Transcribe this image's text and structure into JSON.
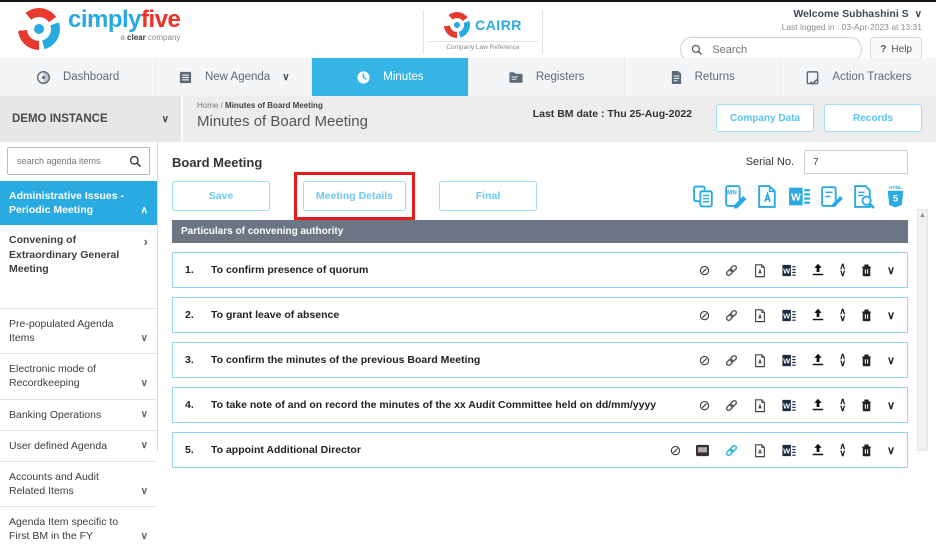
{
  "header": {
    "brand": {
      "cimply": "cimply",
      "five": "five",
      "tagline_pre": "a ",
      "tagline_bold": "clear",
      "tagline_post": " company"
    },
    "cairr": {
      "title": "CAIRR",
      "subtitle": "Company Law Reference"
    },
    "welcome": "Welcome Subhashini  S",
    "last_logged_in": "Last logged in : 03-Apr-2023 at 13:31",
    "search_placeholder": "Search",
    "help_q": "?",
    "help_label": "Help"
  },
  "nav": {
    "items": [
      {
        "label": "Dashboard",
        "icon": "dashboard-icon",
        "active": false
      },
      {
        "label": "New Agenda",
        "icon": "new-agenda-icon",
        "active": false,
        "has_dropdown": true
      },
      {
        "label": "Minutes",
        "icon": "clock-icon",
        "active": true
      },
      {
        "label": "Registers",
        "icon": "folder-icon",
        "active": false
      },
      {
        "label": "Returns",
        "icon": "document-icon",
        "active": false
      },
      {
        "label": "Action Trackers",
        "icon": "clipboard-check-icon",
        "active": false
      }
    ]
  },
  "band": {
    "instance": "DEMO INSTANCE",
    "breadcrumb_home": "Home",
    "breadcrumb_sep": "/",
    "breadcrumb_current": "Minutes of Board Meeting",
    "page_title": "Minutes of Board Meeting",
    "last_bm_date": "Last BM date : Thu 25-Aug-2022",
    "company_data_label": "Company Data",
    "records_label": "Records"
  },
  "sidebar": {
    "search_placeholder": "search agenda items",
    "items": [
      {
        "label": "Administrative Issues - Periodic Meeting",
        "chevron": "up",
        "active": true
      },
      {
        "label": "Convening of Extraordinary General Meeting",
        "chevron": "right",
        "active": false
      },
      {
        "label": "Pre-populated Agenda Items",
        "chevron": "down",
        "active": false
      },
      {
        "label": "Electronic mode of Recordkeeping",
        "chevron": "down",
        "active": false
      },
      {
        "label": "Banking Operations",
        "chevron": "down",
        "active": false
      },
      {
        "label": "User defined Agenda",
        "chevron": "down",
        "active": false
      },
      {
        "label": "Accounts and Audit Related Items",
        "chevron": "down",
        "active": false
      },
      {
        "label": "Agenda Item specific to First BM in the FY",
        "chevron": "down",
        "active": false
      }
    ],
    "chev_up": "∧",
    "chev_down": "∨",
    "chev_right": "›"
  },
  "main": {
    "title": "Board Meeting",
    "buttons": {
      "save": "Save",
      "meeting_details": "Meeting Details",
      "final": "Final"
    },
    "serial_label": "Serial No.",
    "serial_value": "7",
    "toolbar_icons": [
      "copy-icon",
      "minutes-edit-icon",
      "pdf-export-icon",
      "word-export-icon",
      "edit-document-icon",
      "preview-search-icon",
      "html5-export-icon"
    ],
    "section_header": "Particulars of convening authority",
    "row_action_icons": [
      "disable-icon",
      "link-icon",
      "pdf-icon",
      "word-icon",
      "upload-icon",
      "move-up-icon",
      "move-down-icon",
      "delete-icon",
      "expand-icon"
    ],
    "rows": [
      {
        "num": "1.",
        "text": "To confirm presence of quorum"
      },
      {
        "num": "2.",
        "text": "To grant leave of absence"
      },
      {
        "num": "3.",
        "text": "To confirm the minutes of the previous Board Meeting"
      },
      {
        "num": "4.",
        "text": "To take note of and on record the minutes of the xx Audit Committee held on dd/mm/yyyy"
      },
      {
        "num": "5.",
        "text": "To appoint Additional Director",
        "extra_icon": "form-grid-icon",
        "link_active": true
      }
    ],
    "chev_up": "∧",
    "chev_down": "∨",
    "scroll_up_arrow": "▲"
  },
  "colors": {
    "accent": "#29abe2",
    "tab_active": "#35b5e5",
    "brand_red": "#ee3124",
    "section_bar": "#6b7583",
    "row_border": "#8ed6f3",
    "annotation_red": "#e31e1e"
  }
}
